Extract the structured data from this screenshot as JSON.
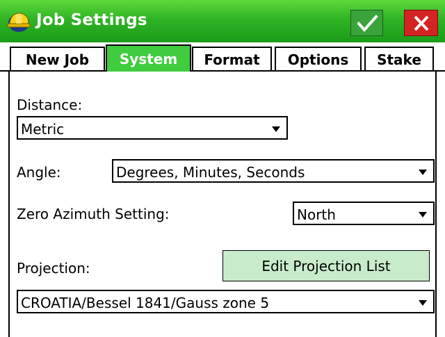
{
  "window": {
    "title": "Job Settings"
  },
  "tabs": [
    {
      "label": "New Job"
    },
    {
      "label": "System"
    },
    {
      "label": "Format"
    },
    {
      "label": "Options"
    },
    {
      "label": "Stake"
    }
  ],
  "active_tab": "System",
  "form": {
    "distance": {
      "label": "Distance:",
      "value": "Metric"
    },
    "angle": {
      "label": "Angle:",
      "value": "Degrees, Minutes, Seconds"
    },
    "zero_azimuth": {
      "label": "Zero Azimuth Setting:",
      "value": "North"
    },
    "projection": {
      "label": "Projection:",
      "value": "CROATIA/Bessel 1841/Gauss zone 5",
      "edit_button": "Edit Projection List"
    }
  },
  "colors": {
    "titlebar": "#2fb424",
    "active_tab": "#3fcc3f",
    "ok": "#3aa43a",
    "close": "#d42323",
    "edit_button": "#c8eccb"
  },
  "icons": {
    "app": "hard-hat-icon",
    "ok": "checkmark-icon",
    "close": "close-icon",
    "dropdown": "chevron-down-icon"
  }
}
